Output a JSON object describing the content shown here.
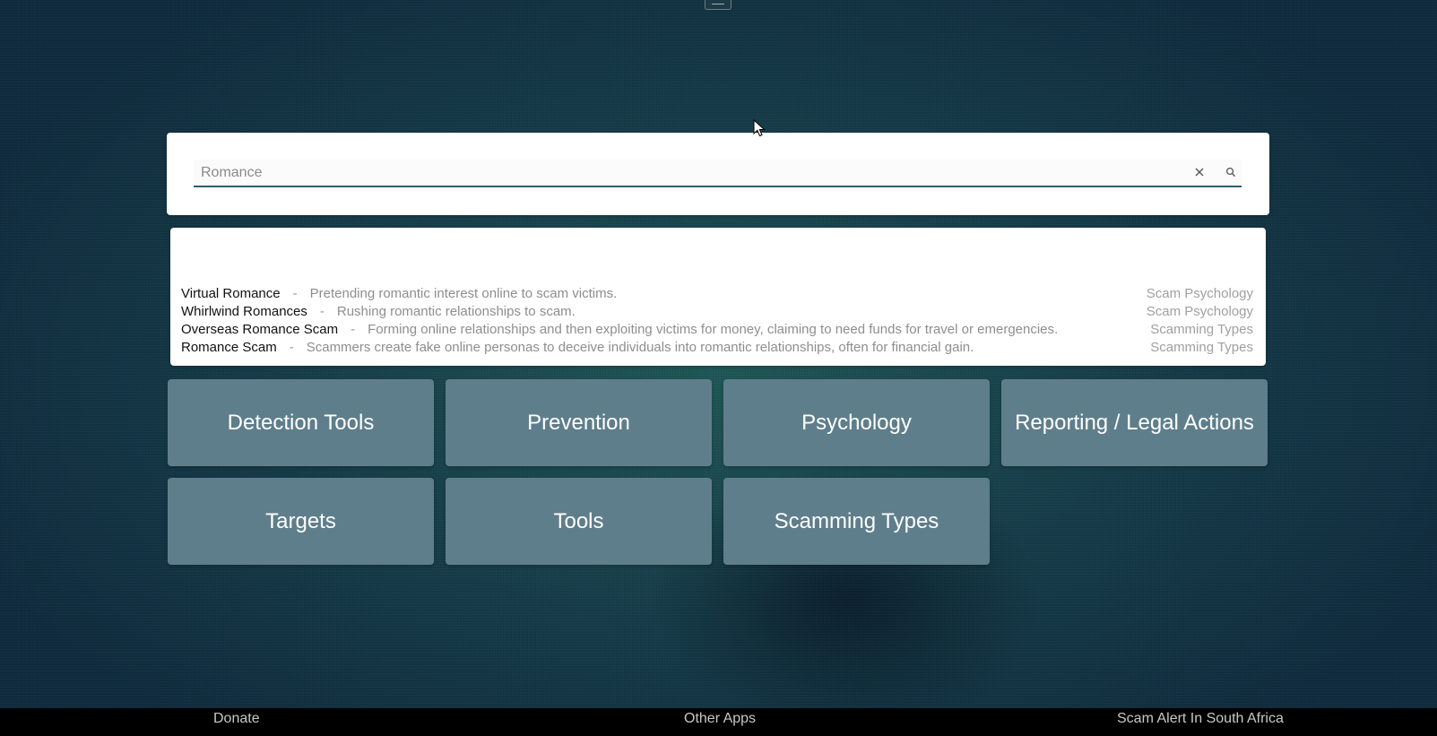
{
  "search": {
    "value": "Romance",
    "clear_icon": "close-icon",
    "search_icon": "magnifier-icon"
  },
  "results": [
    {
      "title": "Virtual Romance",
      "separator": "-",
      "description": "Pretending romantic interest online to scam victims.",
      "category": "Scam Psychology"
    },
    {
      "title": "Whirlwind Romances",
      "separator": "-",
      "description": "Rushing romantic relationships to scam.",
      "category": "Scam Psychology"
    },
    {
      "title": "Overseas Romance Scam",
      "separator": "-",
      "description": "Forming online relationships and then exploiting victims for money, claiming to need funds for travel or emergencies.",
      "category": "Scamming Types"
    },
    {
      "title": "Romance Scam",
      "separator": "-",
      "description": "Scammers create fake online personas to deceive individuals into romantic relationships, often for financial gain.",
      "category": "Scamming Types"
    }
  ],
  "tiles": [
    "Detection Tools",
    "Prevention",
    "Psychology",
    "Reporting / Legal Actions",
    "Targets",
    "Tools",
    "Scamming Types"
  ],
  "footer": {
    "donate": "Donate",
    "other_apps": "Other Apps",
    "scam_alert": "Scam Alert In South Africa"
  },
  "colors": {
    "tile_bg": "#5f7e8b",
    "input_underline": "#2e5f6a",
    "footer_bg": "#000000"
  }
}
